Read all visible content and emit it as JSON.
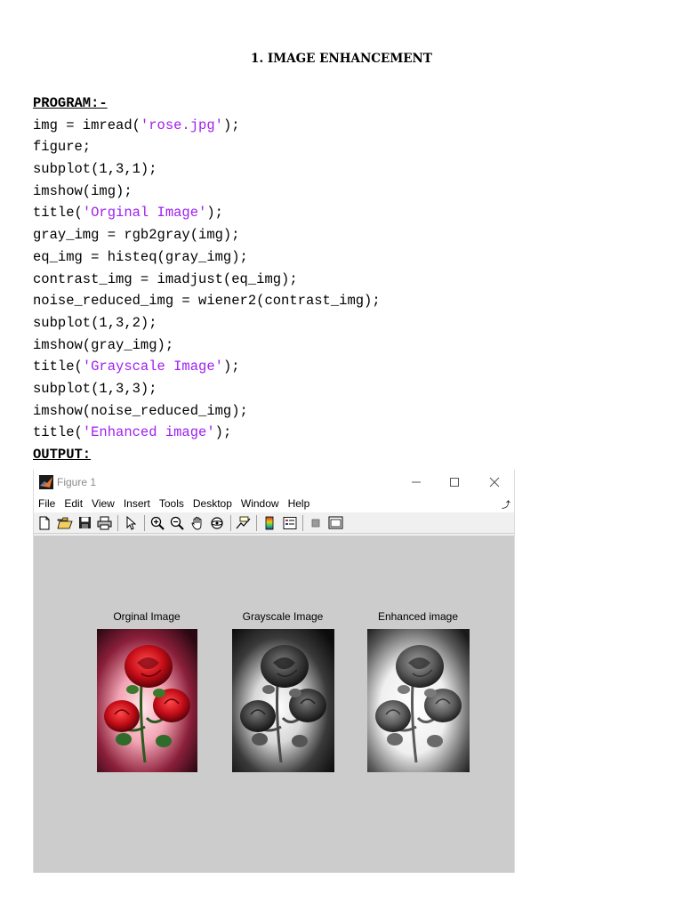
{
  "document": {
    "title": "1. IMAGE ENHANCEMENT",
    "program_heading": "PROGRAM:-",
    "output_heading": "OUTPUT:",
    "code": [
      {
        "pre": "img = imread(",
        "str": "'rose.jpg'",
        "post": ");"
      },
      {
        "pre": "figure;",
        "str": "",
        "post": ""
      },
      {
        "pre": "subplot(1,3,1);",
        "str": "",
        "post": ""
      },
      {
        "pre": "imshow(img);",
        "str": "",
        "post": ""
      },
      {
        "pre": "title(",
        "str": "'Orginal Image'",
        "post": ");"
      },
      {
        "pre": "gray_img = rgb2gray(img);",
        "str": "",
        "post": ""
      },
      {
        "pre": "eq_img = histeq(gray_img);",
        "str": "",
        "post": ""
      },
      {
        "pre": "contrast_img = imadjust(eq_img);",
        "str": "",
        "post": ""
      },
      {
        "pre": "noise_reduced_img = wiener2(contrast_img);",
        "str": "",
        "post": ""
      },
      {
        "pre": "subplot(1,3,2);",
        "str": "",
        "post": ""
      },
      {
        "pre": "imshow(gray_img);",
        "str": "",
        "post": ""
      },
      {
        "pre": "title(",
        "str": "'Grayscale Image'",
        "post": ");"
      },
      {
        "pre": "subplot(1,3,3);",
        "str": "",
        "post": ""
      },
      {
        "pre": "imshow(noise_reduced_img);",
        "str": "",
        "post": ""
      },
      {
        "pre": "title(",
        "str": "'Enhanced image'",
        "post": ");"
      }
    ],
    "string_color": "#a020f0"
  },
  "figure_window": {
    "title": "Figure 1",
    "menus": [
      "File",
      "Edit",
      "View",
      "Insert",
      "Tools",
      "Desktop",
      "Window",
      "Help"
    ],
    "toolbar_icons": [
      "new-file-icon",
      "open-folder-icon",
      "save-icon",
      "print-icon",
      "pointer-icon",
      "zoom-in-icon",
      "zoom-out-icon",
      "pan-hand-icon",
      "rotate-3d-icon",
      "data-cursor-icon",
      "colorbar-icon",
      "legend-icon",
      "hide-tools-icon",
      "dock-icon"
    ],
    "canvas_color": "#cccccc",
    "subplots": [
      {
        "title": "Orginal Image",
        "variant": "color"
      },
      {
        "title": "Grayscale Image",
        "variant": "gray"
      },
      {
        "title": "Enhanced image",
        "variant": "enhanced"
      }
    ]
  }
}
